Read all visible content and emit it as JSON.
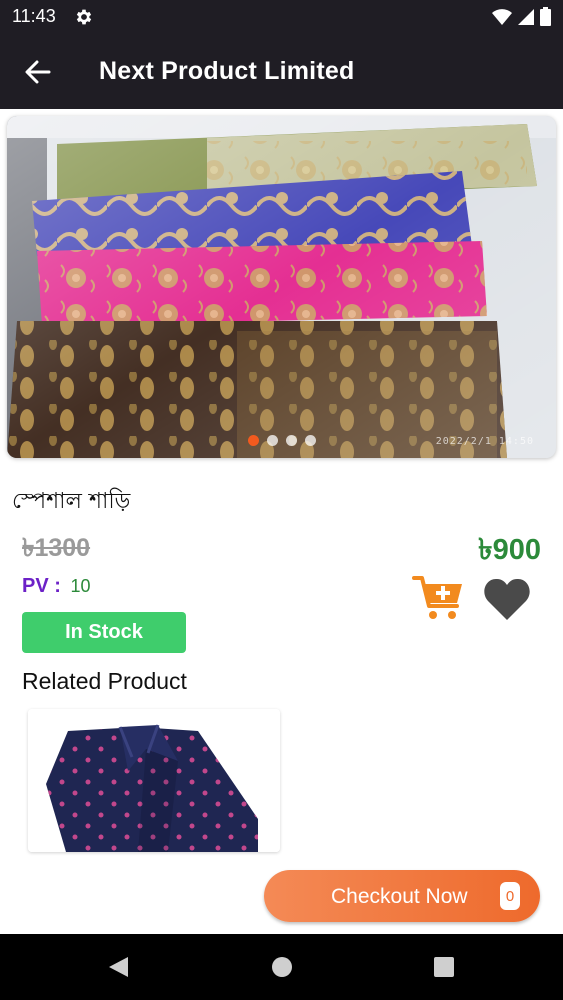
{
  "status_bar": {
    "time": "11:43",
    "icons": [
      "gear-icon",
      "wifi-icon",
      "signal-icon",
      "battery-icon"
    ]
  },
  "app_bar": {
    "title": "Next Product Limited",
    "back_icon": "arrow-left-icon"
  },
  "carousel": {
    "image_count": 4,
    "active_index": 0,
    "stamp": "2022/2/1 14:50"
  },
  "product": {
    "name": "স্পেশাল শাড়ি",
    "old_price": "৳1300",
    "new_price": "৳900",
    "pv_label": "PV :",
    "pv_value": "10",
    "stock_status": "In Stock"
  },
  "related": {
    "title": "Related Product"
  },
  "checkout": {
    "label": "Checkout Now",
    "count": "0"
  },
  "colors": {
    "app_bar": "#1f1d24",
    "accent_orange": "#ee6a2c",
    "price_green": "#2c8a3a",
    "pv_purple": "#6c21c7",
    "stock_green": "#3fcd6c"
  }
}
